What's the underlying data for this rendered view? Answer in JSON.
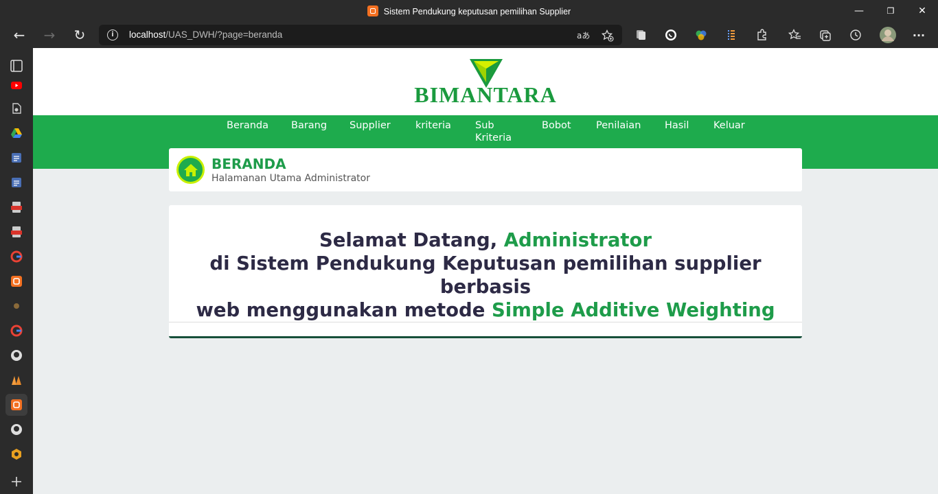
{
  "window": {
    "title": "Sistem Pendukung keputusan pemilihan Supplier",
    "minimize": "—",
    "restore": "❐",
    "close": "✕"
  },
  "toolbar": {
    "back": "←",
    "forward": "→",
    "refresh": "↻",
    "url_host": "localhost",
    "url_path": "/UAS_DWH/?page=beranda",
    "read_aloud": "aあ",
    "more": "···"
  },
  "brand": {
    "name": "BIMANTARA"
  },
  "nav": {
    "items": [
      {
        "label": "Beranda"
      },
      {
        "label": "Barang"
      },
      {
        "label": "Supplier"
      },
      {
        "label": "kriteria"
      },
      {
        "label": "Sub Kriteria"
      },
      {
        "label": "Bobot"
      },
      {
        "label": "Penilaian"
      },
      {
        "label": "Hasil"
      },
      {
        "label": "Keluar"
      }
    ]
  },
  "page_header": {
    "title": "BERANDA",
    "subtitle": "Halamanan Utama Administrator"
  },
  "welcome": {
    "greeting": "Selamat Datang, ",
    "user": "Administrator",
    "line2": "di Sistem Pendukung Keputusan pemilihan supplier berbasis",
    "line3_prefix": "web menggunakan metode ",
    "method": "Simple Additive Weighting"
  },
  "colors": {
    "brand_green": "#1eab4d",
    "accent_lime": "#c8f000",
    "text_dark": "#2d2a45"
  }
}
